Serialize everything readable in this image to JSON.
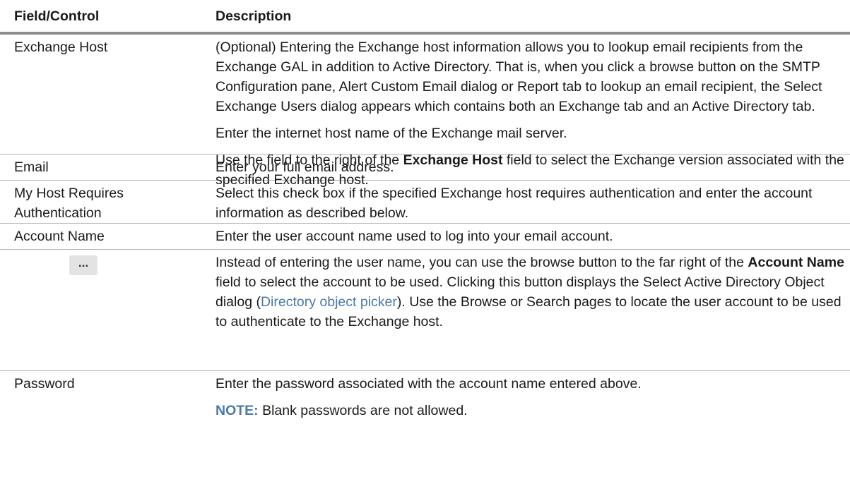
{
  "header": {
    "field_label": "Field/Control",
    "description_label": "Description"
  },
  "rows": {
    "exchange_host": {
      "field": "Exchange Host",
      "p1": "(Optional) Entering the Exchange host information allows you to lookup email recipients from the Exchange GAL in addition to Active Directory. That is, when you click a browse button on the SMTP Configuration pane, Alert Custom Email dialog or Report tab to lookup an email recipient, the Select Exchange Users dialog appears which contains both an Exchange tab and an Active Directory tab.",
      "p2": "Enter the internet host name of the Exchange mail server.",
      "p3_before": "Use the field to the right of the ",
      "p3_bold": "Exchange Host",
      "p3_after": " field to select the Exchange version associated with the specified Exchange host."
    },
    "email": {
      "field": "Email",
      "desc": "Enter your full email address."
    },
    "my_host": {
      "field": "My Host Requires Authentication",
      "desc": "Select this check box if the specified Exchange host requires authentication and enter the account information as described below."
    },
    "account_name": {
      "field": "Account Name",
      "desc": "Enter the user account name used to log into your email account."
    },
    "browse": {
      "button_label": "...",
      "d_before": "Instead of entering the user name, you can use the browse button to the far right of the ",
      "d_bold": "Account Name",
      "d_middle": " field to select the account to be used. Clicking this button displays the Select Active Directory Object dialog (",
      "d_link": "Directory object picker",
      "d_after": "). Use the Browse or Search pages to locate the user account to be used to authenticate to the Exchange host."
    },
    "password": {
      "field": "Password",
      "desc": "Enter the password associated with the account name entered above.",
      "note_label": "NOTE:",
      "note_text": " Blank passwords are not allowed."
    }
  }
}
